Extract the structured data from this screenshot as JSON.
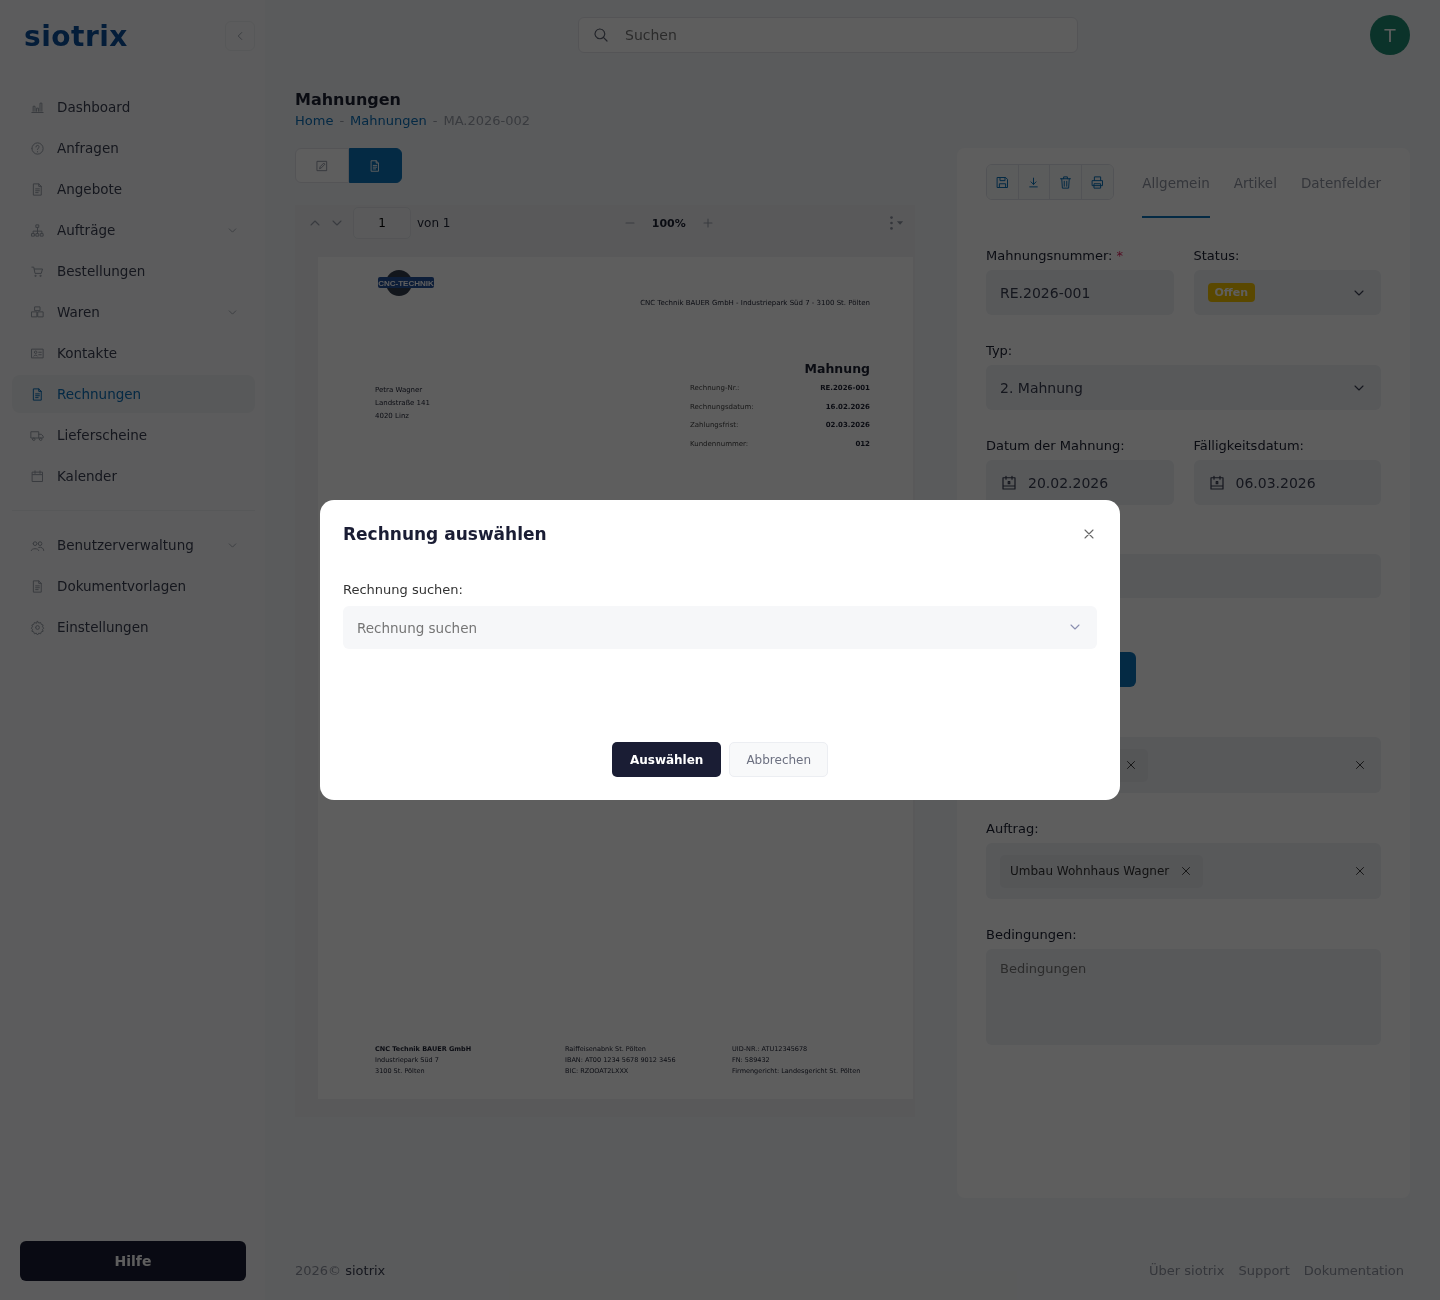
{
  "brand": "siotrix",
  "search": {
    "placeholder": "Suchen"
  },
  "user": {
    "initial": "T"
  },
  "nav": [
    {
      "label": "Dashboard",
      "selected": false,
      "expandable": false
    },
    {
      "label": "Anfragen",
      "selected": false,
      "expandable": false
    },
    {
      "label": "Angebote",
      "selected": false,
      "expandable": false
    },
    {
      "label": "Aufträge",
      "selected": false,
      "expandable": true
    },
    {
      "label": "Bestellungen",
      "selected": false,
      "expandable": false
    },
    {
      "label": "Waren",
      "selected": false,
      "expandable": true
    },
    {
      "label": "Kontakte",
      "selected": false,
      "expandable": false
    },
    {
      "label": "Rechnungen",
      "selected": true,
      "expandable": false
    },
    {
      "label": "Lieferscheine",
      "selected": false,
      "expandable": false
    },
    {
      "label": "Kalender",
      "selected": false,
      "expandable": false
    }
  ],
  "nav_secondary": [
    {
      "label": "Benutzerverwaltung",
      "selected": false,
      "expandable": true
    },
    {
      "label": "Dokumentvorlagen",
      "selected": false,
      "expandable": false
    },
    {
      "label": "Einstellungen",
      "selected": false,
      "expandable": false
    }
  ],
  "help_button": "Hilfe",
  "page": {
    "title": "Mahnungen",
    "breadcrumb_separator": "-",
    "breadcrumbs": [
      {
        "label": "Home",
        "link": true
      },
      {
        "label": "Mahnungen",
        "link": true
      },
      {
        "label": "MA.2026-002",
        "link": false
      }
    ]
  },
  "view_toggle": [
    {
      "kind": "edit",
      "selected": false
    },
    {
      "kind": "preview",
      "selected": true
    }
  ],
  "viewer": {
    "page_input": "1",
    "page_count": "von 1",
    "zoom": "100%"
  },
  "document": {
    "logo_text": "CNC-TECHNIK",
    "sender_line": "CNC Technik BAUER GmbH - Industriepark Süd 7 - 3100 St. Pölten",
    "title": "Mahnung",
    "recipient": [
      "Petra Wagner",
      "Landstraße 141",
      "4020 Linz"
    ],
    "meta": [
      {
        "label": "Rechnung-Nr.:",
        "value": "RE.2026-001"
      },
      {
        "label": "Rechnungsdatum:",
        "value": "16.02.2026"
      },
      {
        "label": "Zahlungsfrist:",
        "value": "02.03.2026"
      },
      {
        "label": "Kundennummer:",
        "value": "012"
      }
    ],
    "footer_columns": [
      {
        "heading": "CNC Technik BAUER GmbH",
        "lines": [
          "Industriepark Süd 7",
          "3100 St. Pölten"
        ]
      },
      {
        "lines": [
          "Raiffeisenabnk St. Pölten",
          "IBAN:  AT00 1234 5678 9012 3456",
          "BIC: RZOOAT2LXXX"
        ]
      },
      {
        "lines": [
          "UID-NR.: ATU12345678",
          "FN: 589432",
          "Firmengericht: Landesgericht St. Pölten"
        ]
      }
    ]
  },
  "actions": [
    {
      "kind": "save"
    },
    {
      "kind": "download"
    },
    {
      "kind": "delete"
    },
    {
      "kind": "print"
    }
  ],
  "tabs": [
    {
      "label": "Allgemein",
      "selected": true
    },
    {
      "label": "Artikel",
      "selected": false
    },
    {
      "label": "Datenfelder",
      "selected": false
    }
  ],
  "form": {
    "number": {
      "label": "Mahnungsnummer:",
      "required_mark": "*",
      "value": "RE.2026-001"
    },
    "status": {
      "label": "Status:",
      "badge": "Offen"
    },
    "type": {
      "label": "Typ:",
      "value": "2. Mahnung"
    },
    "date": {
      "label": "Datum der Mahnung:",
      "value": "20.02.2026"
    },
    "due": {
      "label": "Fälligkeitsdatum:",
      "value": "06.03.2026"
    },
    "order": {
      "label": "Auftrag:",
      "chip": "Umbau Wohnhaus Wagner"
    },
    "terms": {
      "label": "Bedingungen:",
      "placeholder": "Bedingungen"
    }
  },
  "modal": {
    "title": "Rechnung auswählen",
    "field_label": "Rechnung suchen:",
    "placeholder": "Rechnung suchen",
    "primary": "Auswählen",
    "secondary": "Abbrechen"
  },
  "footer": {
    "copyright": "2026©",
    "brand": "siotrix",
    "links": [
      "Über siotrix",
      "Support",
      "Dokumentation"
    ]
  }
}
